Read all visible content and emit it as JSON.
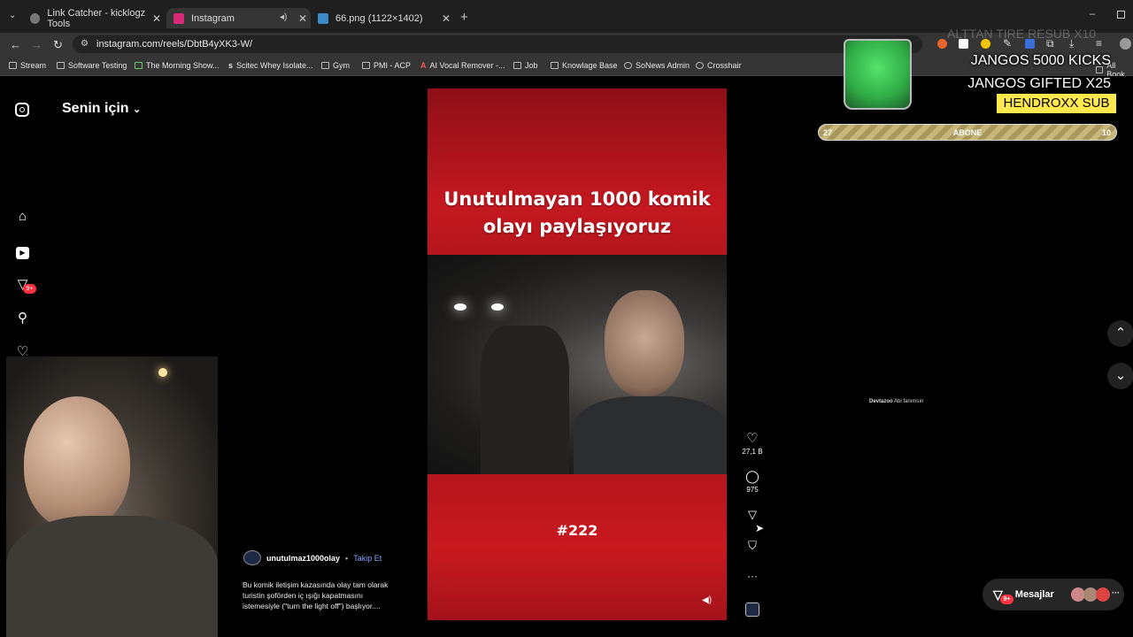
{
  "browser": {
    "tabs": [
      {
        "title": "Link Catcher - kicklogz Tools",
        "color": "#3c7bd9"
      },
      {
        "title": "Instagram",
        "color": "#d62976"
      },
      {
        "title": "66.png (1122×1402)",
        "color": "#3b8bcb"
      }
    ],
    "new_tab_glyph": "+",
    "url": "instagram.com/reels/DbtB4yXK3-W/",
    "bookmarks": [
      "Stream",
      "Software Testing",
      "The Morning Show...",
      "Scitec Whey Isolate...",
      "Gym",
      "PMI - ACP",
      "AI Vocal Remover -...",
      "Job",
      "Knowlage Base",
      "SoNews Admin",
      "Crosshair"
    ],
    "all_bookmarks": "All Book"
  },
  "instagram": {
    "feed_title": "Senin için",
    "notification_badge": "9+",
    "reel": {
      "title_line1": "Unutulmayan 1000 komik",
      "title_line2": "olayı paylaşıyoruz",
      "episode": "#222",
      "username": "unutulmaz1000olay",
      "follow": "Takip Et",
      "caption_line1": "Bu komik iletişim kazasında olay tam olarak",
      "caption_line2": "turistin şoförden iç ışığı kapatmasını",
      "caption_line3": "istemesiyle (\"turn the light off\") başlıyor...."
    },
    "likes": "27,1 B",
    "comments": "975",
    "messages_label": "Mesajlar",
    "messages_badge": "9+"
  },
  "stream_overlay": {
    "faded_line": "ALTTAN  TIRE  RESUB X10",
    "line1": "JANGOS  5000 KICKS",
    "line2": "JANGOS  GIFTED X25",
    "highlight": "HENDROXX  SUB",
    "progress_left": "27",
    "progress_label": "ABONE",
    "progress_right": "10",
    "chat_name": "Devtazoo",
    "chat_msg": "Abi fanımsın"
  },
  "colors": {
    "brand_red": "#b3161e",
    "overlay_yellow": "#ffe94c",
    "follow_blue": "#85a9ff"
  }
}
